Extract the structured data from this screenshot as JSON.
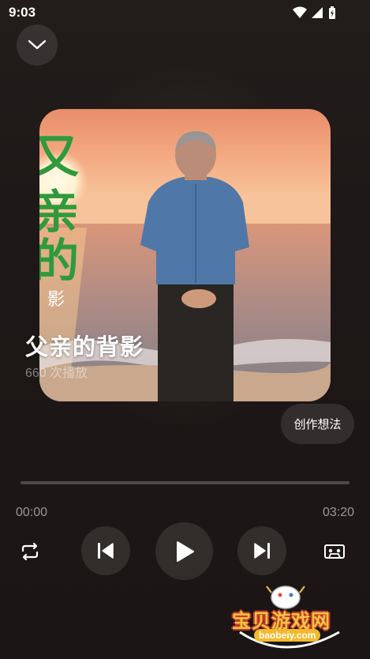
{
  "status_bar": {
    "time": "9:03",
    "icons": [
      "wifi-icon",
      "signal-icon",
      "battery-icon"
    ]
  },
  "header": {
    "collapse_icon": "chevron-down-icon"
  },
  "song": {
    "title": "父亲的背影",
    "play_count": "660 次播放",
    "cover_text": [
      "又",
      "亲",
      "的",
      "影"
    ]
  },
  "actions": {
    "idea_button": "创作想法"
  },
  "player": {
    "current_time": "00:00",
    "total_time": "03:20",
    "progress": 0,
    "controls": [
      "repeat-icon",
      "previous-icon",
      "play-icon",
      "next-icon",
      "cassette-icon"
    ]
  },
  "watermark": {
    "title": "宝贝游戏网",
    "url": "baobeiy.com"
  },
  "colors": {
    "background": "#1c1716",
    "cover_sky": "#f2a77a",
    "cover_text": "#2f9a3c",
    "watermark_yellow": "#f4c642"
  }
}
